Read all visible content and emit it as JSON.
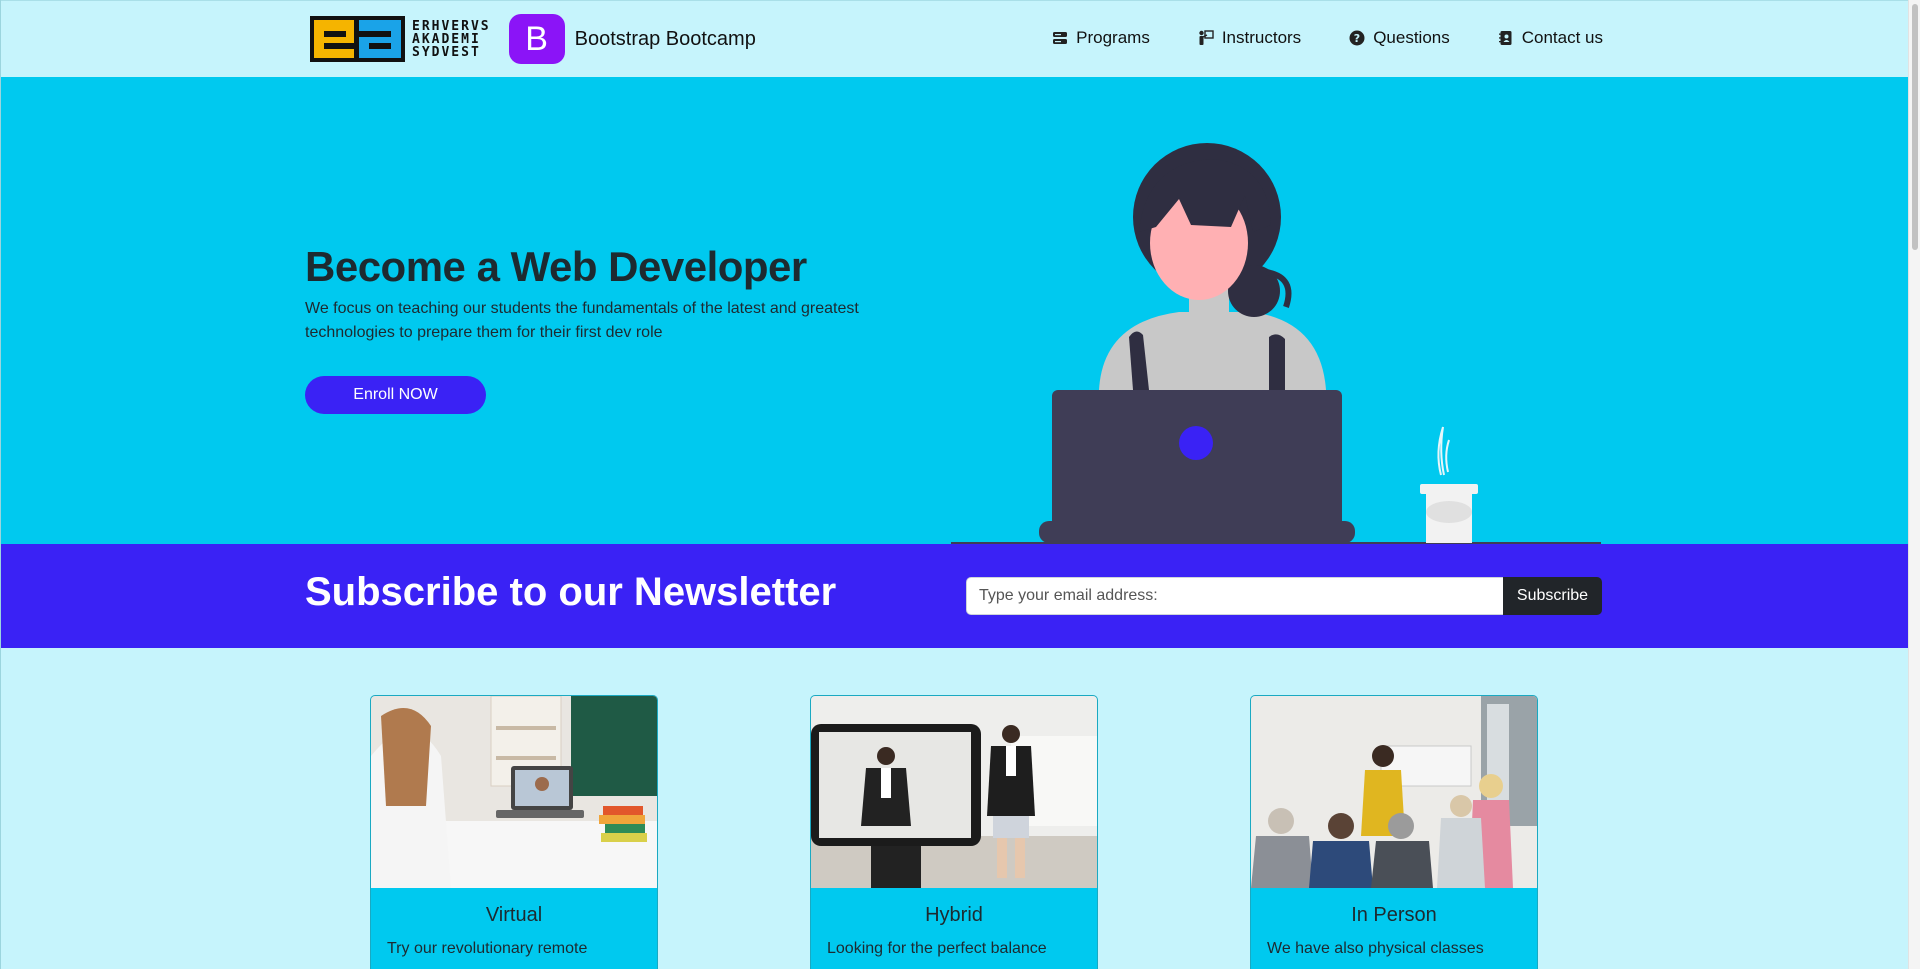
{
  "brand": {
    "ea_text_lines": [
      "ERHVERVS",
      "AKADEMI",
      "SYDVEST"
    ],
    "bootstrap_letter": "B",
    "site_name": "Bootstrap Bootcamp"
  },
  "nav": {
    "items": [
      {
        "label": "Programs",
        "icon": "programs-icon"
      },
      {
        "label": "Instructors",
        "icon": "instructor-icon"
      },
      {
        "label": "Questions",
        "icon": "question-icon"
      },
      {
        "label": "Contact us",
        "icon": "contact-icon"
      }
    ]
  },
  "hero": {
    "title": "Become a Web Developer",
    "lead": "We focus on teaching our students the fundamentals of the latest and greatest technologies to prepare them for their first dev role",
    "cta_label": "Enroll NOW"
  },
  "newsletter": {
    "title": "Subscribe to our Newsletter",
    "placeholder": "Type your email address:",
    "button_label": "Subscribe"
  },
  "cards": [
    {
      "title": "Virtual",
      "text": "Try our revolutionary remote"
    },
    {
      "title": "Hybrid",
      "text": "Looking for the perfect balance"
    },
    {
      "title": "In Person",
      "text": "We have also physical classes"
    }
  ],
  "colors": {
    "page_bg": "#c6f4fc",
    "hero_bg": "#00c9ef",
    "accent": "#3a22f5",
    "dark": "#212529",
    "bootstrap_purple": "#8b14f7"
  }
}
